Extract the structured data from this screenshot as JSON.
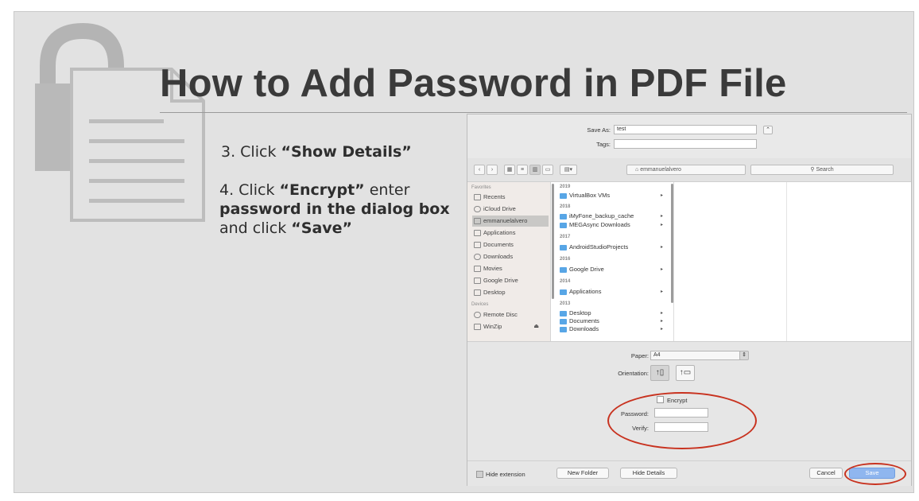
{
  "title": "How to Add Password in PDF File",
  "steps": {
    "s3_pre": "3. Click ",
    "s3_bold": "“Show Details”",
    "s4_pre": "4. Click ",
    "s4_bold1": "“Encrypt”",
    "s4_mid": " enter",
    "s4_bold2": "password in the dialog box",
    "s4_post": "and click ",
    "s4_bold3": "“Save”"
  },
  "dialog": {
    "save_as_label": "Save As:",
    "save_as_value": "test",
    "tags_label": "Tags:",
    "expand_glyph": "⌃",
    "location": "emmanuelalvero",
    "search_placeholder": "Search",
    "sidebar": {
      "favorites_header": "Favorites",
      "devices_header": "Devices",
      "items": [
        {
          "label": "Recents"
        },
        {
          "label": "iCloud Drive"
        },
        {
          "label": "emmanuelalvero"
        },
        {
          "label": "Applications"
        },
        {
          "label": "Documents"
        },
        {
          "label": "Downloads"
        },
        {
          "label": "Movies"
        },
        {
          "label": "Google Drive"
        },
        {
          "label": "Desktop"
        }
      ],
      "devices": [
        {
          "label": "Remote Disc"
        },
        {
          "label": "WinZip"
        }
      ]
    },
    "column": [
      {
        "type": "year",
        "label": "2019"
      },
      {
        "type": "folder",
        "label": "VirtualBox VMs"
      },
      {
        "type": "year",
        "label": "2018"
      },
      {
        "type": "folder",
        "label": "iMyFone_backup_cache"
      },
      {
        "type": "folder",
        "label": "MEGAsync Downloads"
      },
      {
        "type": "year",
        "label": "2017"
      },
      {
        "type": "folder",
        "label": "AndroidStudioProjects"
      },
      {
        "type": "year",
        "label": "2016"
      },
      {
        "type": "folder",
        "label": "Google Drive"
      },
      {
        "type": "year",
        "label": "2014"
      },
      {
        "type": "folder",
        "label": "Applications"
      },
      {
        "type": "year",
        "label": "2013"
      },
      {
        "type": "folder",
        "label": "Desktop"
      },
      {
        "type": "folder",
        "label": "Documents"
      },
      {
        "type": "folder",
        "label": "Downloads"
      }
    ],
    "paper_label": "Paper:",
    "paper_value": "A4",
    "orientation_label": "Orientation:",
    "encrypt_label": "Encrypt",
    "password_label": "Password:",
    "verify_label": "Verify:",
    "hide_extension_label": "Hide extension",
    "new_folder_label": "New Folder",
    "hide_details_label": "Hide Details",
    "cancel_label": "Cancel",
    "save_label": "Save"
  },
  "colors": {
    "highlight": "#c8321f",
    "folder": "#58a6e6",
    "save_button": "#8fb6ef"
  }
}
